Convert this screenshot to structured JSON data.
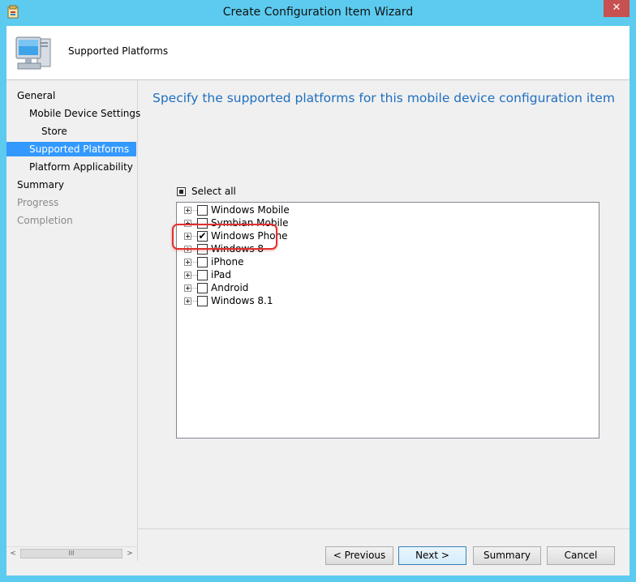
{
  "window": {
    "title": "Create Configuration Item Wizard",
    "close_glyph": "✕"
  },
  "header": {
    "title": "Supported Platforms",
    "icon": "computer-monitor-icon"
  },
  "nav": {
    "items": [
      {
        "label": "General",
        "state": "normal"
      },
      {
        "label": "Mobile Device Settings",
        "state": "normal"
      },
      {
        "label": "Store",
        "state": "normal"
      },
      {
        "label": "Supported Platforms",
        "state": "selected"
      },
      {
        "label": "Platform Applicability",
        "state": "normal"
      },
      {
        "label": "Summary",
        "state": "normal"
      },
      {
        "label": "Progress",
        "state": "disabled"
      },
      {
        "label": "Completion",
        "state": "disabled"
      }
    ],
    "scrollbar": {
      "left_arrow": "<",
      "right_arrow": ">",
      "thumb_grip": "III"
    }
  },
  "content": {
    "heading": "Specify the supported platforms for this mobile device configuration item",
    "select_all": {
      "label": "Select all",
      "state": "indeterminate"
    },
    "platforms": [
      {
        "label": "Windows Mobile",
        "checked": false
      },
      {
        "label": "Symbian Mobile",
        "checked": false
      },
      {
        "label": "Windows Phone",
        "checked": true
      },
      {
        "label": "Windows 8",
        "checked": false
      },
      {
        "label": "iPhone",
        "checked": false
      },
      {
        "label": "iPad",
        "checked": false
      },
      {
        "label": "Android",
        "checked": false
      },
      {
        "label": "Windows 8.1",
        "checked": false
      }
    ],
    "check_glyph": "✔"
  },
  "buttons": {
    "previous": "< Previous",
    "next": "Next >",
    "summary": "Summary",
    "cancel": "Cancel"
  },
  "colors": {
    "title_bar": "#5ccbef",
    "selection": "#3399ff",
    "heading": "#1e6fbf",
    "callout": "#e03030"
  }
}
